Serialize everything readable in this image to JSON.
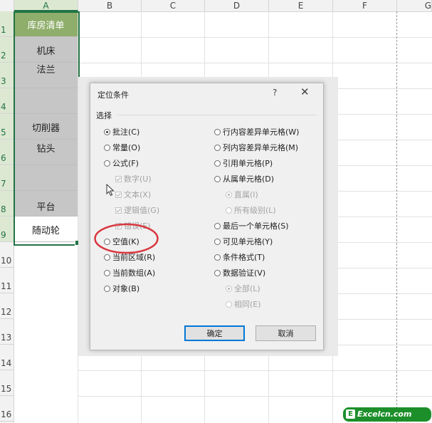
{
  "sheet": {
    "columns": [
      "A",
      "B",
      "C",
      "D",
      "E",
      "F",
      "G"
    ],
    "rows": [
      "1",
      "2",
      "3",
      "4",
      "5",
      "6",
      "7",
      "8",
      "9",
      "10",
      "11",
      "12",
      "13",
      "14",
      "15",
      "16"
    ],
    "column_a": [
      "库房清单",
      "机床",
      "法兰",
      "",
      "切削器",
      "钻头",
      "",
      "平台",
      "随动轮"
    ]
  },
  "dialog": {
    "title": "定位条件",
    "help_glyph": "?",
    "close_glyph": "✕",
    "group_label": "选择",
    "left_options": [
      {
        "label": "批注(C)",
        "type": "radio",
        "selected": true,
        "enabled": true
      },
      {
        "label": "常量(O)",
        "type": "radio",
        "selected": false,
        "enabled": true
      },
      {
        "label": "公式(F)",
        "type": "radio",
        "selected": false,
        "enabled": true
      },
      {
        "label": "数字(U)",
        "type": "checkbox",
        "checked": true,
        "enabled": false
      },
      {
        "label": "文本(X)",
        "type": "checkbox",
        "checked": true,
        "enabled": false
      },
      {
        "label": "逻辑值(G)",
        "type": "checkbox",
        "checked": true,
        "enabled": false
      },
      {
        "label": "错误(E)",
        "type": "checkbox",
        "checked": true,
        "enabled": false
      },
      {
        "label": "空值(K)",
        "type": "radio",
        "selected": false,
        "enabled": true
      },
      {
        "label": "当前区域(R)",
        "type": "radio",
        "selected": false,
        "enabled": true
      },
      {
        "label": "当前数组(A)",
        "type": "radio",
        "selected": false,
        "enabled": true
      },
      {
        "label": "对象(B)",
        "type": "radio",
        "selected": false,
        "enabled": true
      }
    ],
    "right_options": [
      {
        "label": "行内容差异单元格(W)",
        "type": "radio",
        "selected": false,
        "enabled": true
      },
      {
        "label": "列内容差异单元格(M)",
        "type": "radio",
        "selected": false,
        "enabled": true
      },
      {
        "label": "引用单元格(P)",
        "type": "radio",
        "selected": false,
        "enabled": true
      },
      {
        "label": "从属单元格(D)",
        "type": "radio",
        "selected": false,
        "enabled": true
      },
      {
        "label": "直属(I)",
        "type": "radio",
        "selected": true,
        "enabled": false
      },
      {
        "label": "所有级别(L)",
        "type": "radio",
        "selected": false,
        "enabled": false
      },
      {
        "label": "最后一个单元格(S)",
        "type": "radio",
        "selected": false,
        "enabled": true
      },
      {
        "label": "可见单元格(Y)",
        "type": "radio",
        "selected": false,
        "enabled": true
      },
      {
        "label": "条件格式(T)",
        "type": "radio",
        "selected": false,
        "enabled": true
      },
      {
        "label": "数据验证(V)",
        "type": "radio",
        "selected": false,
        "enabled": true
      },
      {
        "label": "全部(L)",
        "type": "radio",
        "selected": true,
        "enabled": false
      },
      {
        "label": "相同(E)",
        "type": "radio",
        "selected": false,
        "enabled": false
      }
    ],
    "ok_label": "确定",
    "cancel_label": "取消"
  },
  "annotation": {
    "color": "#d9363e",
    "target": "空值(K)"
  },
  "watermark": {
    "badge": "E",
    "text": "Excelcn.com"
  },
  "colors": {
    "excel_green": "#217346",
    "header_fill": "#8fae6b",
    "cell_gray": "#c6c6c6"
  }
}
